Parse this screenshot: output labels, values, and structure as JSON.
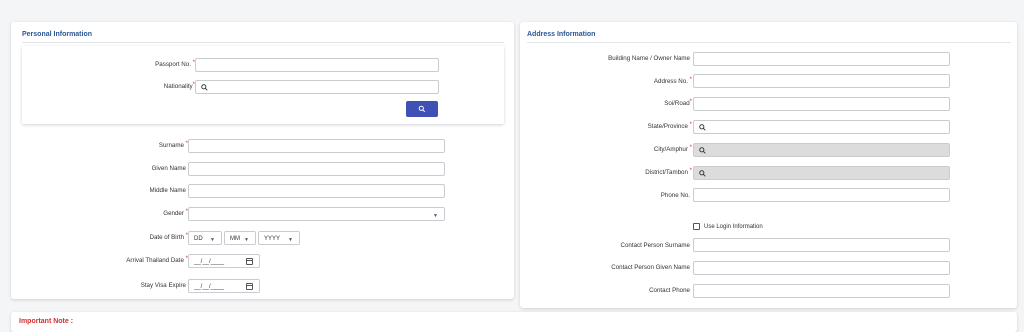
{
  "personal": {
    "title": "Personal Information",
    "passport_label": "Passport No.",
    "nationality_label": "Nationality",
    "surname_label": "Surname",
    "given_name_label": "Given Name",
    "middle_name_label": "Middle Name",
    "gender_label": "Gender",
    "dob_label": "Date of Birth",
    "dob_day": "DD",
    "dob_month": "MM",
    "dob_year": "YYYY",
    "arrival_label": "Arrival Thailand Date",
    "arrival_placeholder": "__/__/____",
    "stay_label": "Stay Visa Expire",
    "stay_placeholder": "__/__/____",
    "required_mark": "*"
  },
  "address": {
    "title": "Address Information",
    "building_label": "Building Name / Owner Name",
    "address_no_label": "Address No.",
    "soi_label": "Soi/Road",
    "state_label": "State/Province",
    "city_label": "City/Amphur",
    "district_label": "District/Tambon",
    "phone_label": "Phone No.",
    "use_login_label": "Use Login Information",
    "contact_surname_label": "Contact Person Surname",
    "contact_given_label": "Contact Person Given Name",
    "contact_phone_label": "Contact Phone"
  },
  "note": {
    "title": "Important Note :"
  },
  "colors": {
    "accent": "#3f51b5",
    "title": "#2b5797",
    "required": "#d32f2f"
  }
}
